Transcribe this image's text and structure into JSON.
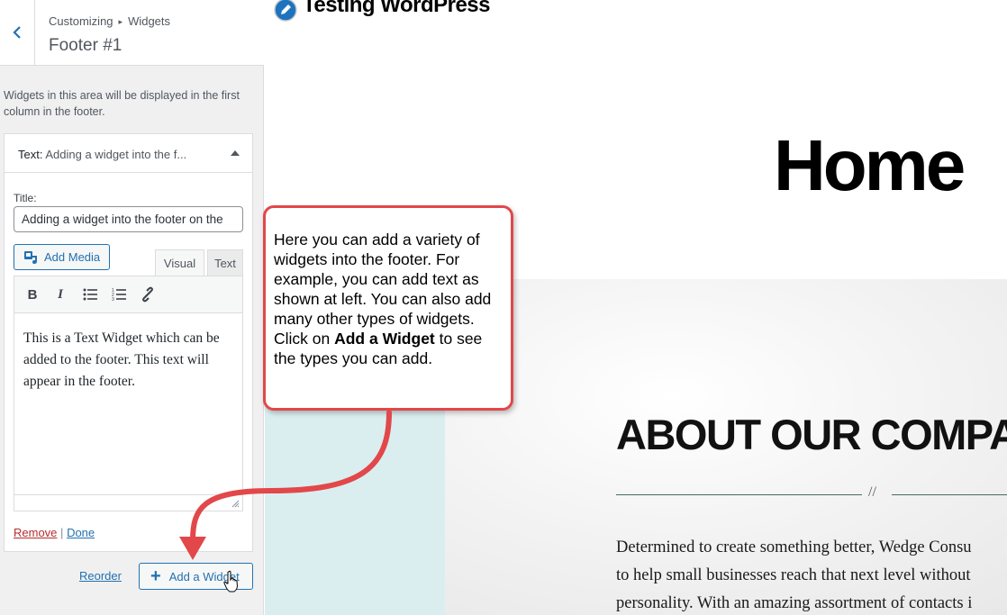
{
  "sidebar": {
    "breadcrumb_parent": "Customizing",
    "breadcrumb_child": "Widgets",
    "section_title": "Footer #1",
    "area_description": "Widgets in this area will be displayed in the first column in the footer.",
    "widget": {
      "type": "Text:",
      "title_preview": "Adding a widget into the f...",
      "title_label": "Title:",
      "title_value": "Adding a widget into the footer on the",
      "add_media_label": "Add Media",
      "tab_visual": "Visual",
      "tab_text": "Text",
      "content": "This is a Text Widget which can be added to the footer.  This text will appear in the footer.",
      "remove_label": "Remove",
      "separator": "|",
      "done_label": "Done"
    },
    "reorder_label": "Reorder",
    "add_widget_label": "Add a Widget"
  },
  "preview": {
    "site_title": "Testing WordPress",
    "page_heading": "Home",
    "about_heading": "ABOUT OUR COMPA",
    "divider_mark": "//",
    "about_lines": [
      "Determined to create something better, Wedge Consu",
      "to help small businesses reach that next level without",
      "personality. With an amazing assortment of contacts i"
    ]
  },
  "callout": {
    "text_start": "Here you can add a variety of widgets into the footer. For example, you can add text as shown at left.  You can also add many other types of widgets.  Click on ",
    "text_bold": "Add a Widget",
    "text_end": " to see the types you can add."
  },
  "colors": {
    "accent": "#2271b1",
    "callout_border": "#e2474a",
    "remove_link": "#b32d2e",
    "teal_band": "#daeef0"
  },
  "icons": [
    "chevron-left-icon",
    "collapse-arrow-icon",
    "media-icon",
    "bold-icon",
    "italic-icon",
    "bullet-list-icon",
    "numbered-list-icon",
    "link-icon",
    "resize-handle-icon",
    "plus-icon",
    "hand-cursor-icon",
    "pencil-logo-icon"
  ]
}
